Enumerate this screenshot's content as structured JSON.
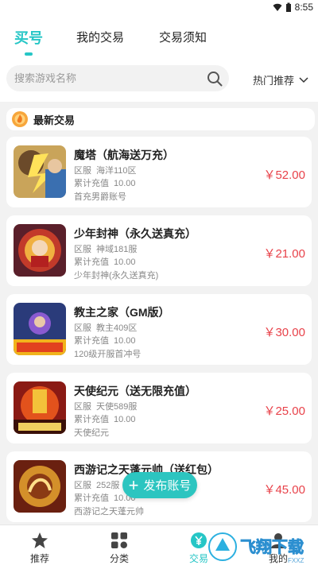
{
  "status_bar": {
    "time": "8:55"
  },
  "tabs": [
    {
      "label": "买号",
      "active": true
    },
    {
      "label": "我的交易",
      "active": false
    },
    {
      "label": "交易须知",
      "active": false
    }
  ],
  "search": {
    "placeholder": "搜索游戏名称",
    "value": ""
  },
  "sort": {
    "label": "热门推荐"
  },
  "section": {
    "title": "最新交易"
  },
  "listings": [
    {
      "name": "魔塔（航海送万充）",
      "server_label": "区服",
      "server": "海洋110区",
      "recharge_label": "累计充值",
      "recharge": "10.00",
      "note": "首充男爵账号",
      "price": "￥52.00"
    },
    {
      "name": "少年封神（永久送真充）",
      "server_label": "区服",
      "server": "神域181服",
      "recharge_label": "累计充值",
      "recharge": "10.00",
      "note": "少年封神(永久送真充)",
      "price": "￥21.00"
    },
    {
      "name": "教主之家（GM版）",
      "server_label": "区服",
      "server": "教主409区",
      "recharge_label": "累计充值",
      "recharge": "10.00",
      "note": "120级开服首冲号",
      "price": "￥30.00"
    },
    {
      "name": "天使纪元（送无限充值）",
      "server_label": "区服",
      "server": "天使589服",
      "recharge_label": "累计充值",
      "recharge": "10.00",
      "note": "天使纪元",
      "price": "￥25.00"
    },
    {
      "name": "西游记之天蓬元帅（送红包）",
      "server_label": "区服",
      "server": "252服",
      "recharge_label": "累计充值",
      "recharge": "10.00",
      "note": "西游记之天蓬元帅",
      "price": "￥45.00"
    }
  ],
  "fab": {
    "label": "发布账号"
  },
  "bottom_nav": [
    {
      "label": "推荐",
      "icon": "star-icon"
    },
    {
      "label": "分类",
      "icon": "grid-icon"
    },
    {
      "label": "交易",
      "icon": "yen-icon"
    },
    {
      "label": "我的",
      "icon": "user-icon"
    }
  ],
  "watermark": {
    "text": "飞翔下载",
    "sub": "FXXZ"
  },
  "colors": {
    "accent": "#26c6c6",
    "price": "#e8424a",
    "background": "#f2f2f2"
  }
}
